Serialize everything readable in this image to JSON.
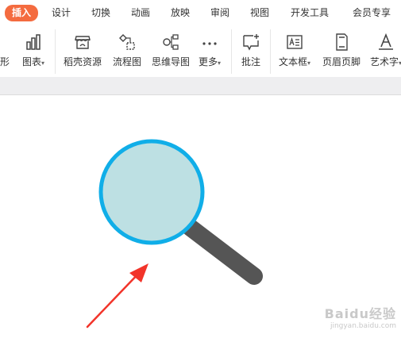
{
  "menu": {
    "tabs": [
      {
        "label": "插入",
        "active": true
      },
      {
        "label": "设计"
      },
      {
        "label": "切换"
      },
      {
        "label": "动画"
      },
      {
        "label": "放映"
      },
      {
        "label": "审阅"
      },
      {
        "label": "视图"
      },
      {
        "label": "开发工具"
      },
      {
        "label": "会员专享"
      }
    ],
    "active_color": "#f46b3f"
  },
  "ribbon": {
    "shape_partial": "形",
    "chart": "图表",
    "daoke": "稻壳资源",
    "flowchart": "流程图",
    "mindmap": "思维导图",
    "more": "更多",
    "comment": "批注",
    "textbox": "文本框",
    "header_footer": "页眉页脚",
    "art_text": "艺术字"
  },
  "dropdown_arrow": "▾",
  "slide": {
    "lens_fill": "#bde0e3",
    "lens_ring": "#10aee8",
    "handle_color": "#555555",
    "arrow_color": "#f2342a"
  },
  "watermark": {
    "main": "Baidu经验",
    "sub": "jingyan.baidu.com"
  }
}
